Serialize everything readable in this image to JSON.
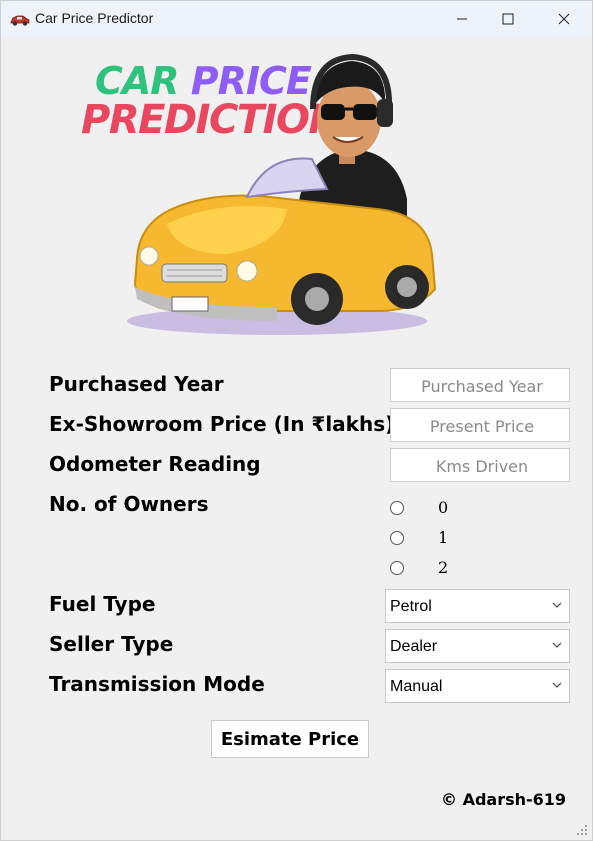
{
  "window": {
    "title": "Car Price Predictor",
    "icon": "car-icon",
    "controls": [
      "minimize-icon",
      "maximize-icon",
      "close-icon"
    ]
  },
  "banner": {
    "word1": "CAR",
    "word2": "PRICE",
    "word3": "PREDICTION",
    "colors": {
      "car": "#2ec27e",
      "price": "#8e5cf7",
      "prediction": "#e8475f"
    }
  },
  "form": {
    "purchased_year": {
      "label": "Purchased Year",
      "placeholder": "Purchased Year"
    },
    "present_price": {
      "label": "Ex-Showroom Price (In ₹lakhs)",
      "placeholder": "Present Price"
    },
    "kms_driven": {
      "label": "Odometer Reading",
      "placeholder": "Kms Driven"
    },
    "owners": {
      "label": "No. of Owners",
      "options": [
        "0",
        "1",
        "2"
      ]
    },
    "fuel_type": {
      "label": "Fuel Type",
      "value": "Petrol"
    },
    "seller_type": {
      "label": "Seller Type",
      "value": "Dealer"
    },
    "transmission": {
      "label": "Transmission Mode",
      "value": "Manual"
    }
  },
  "estimate_button": "Esimate Price",
  "credit": "© Adarsh-619"
}
